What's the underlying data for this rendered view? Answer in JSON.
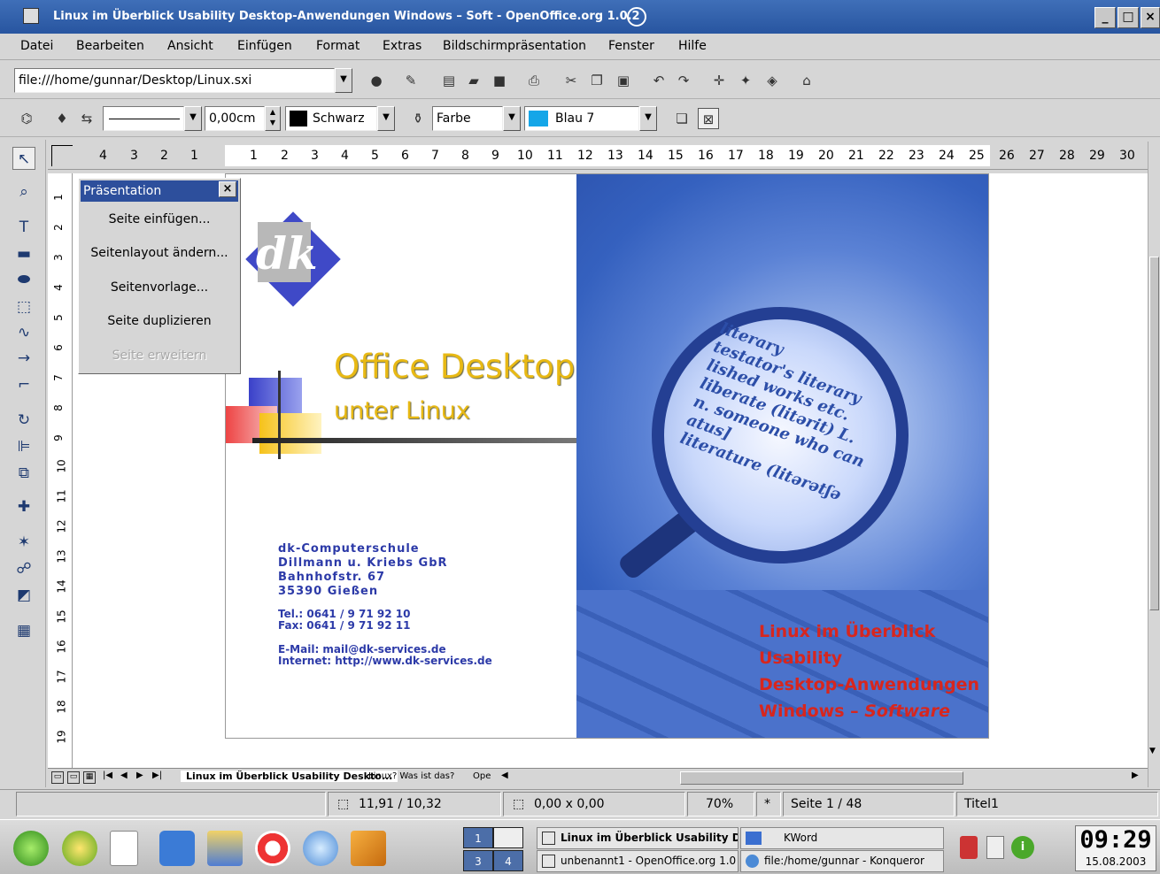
{
  "window": {
    "title": "Linux im Überblick Usability Desktop-Anwendungen Windows – Soft - OpenOffice.org 1.0.2"
  },
  "menu": [
    "Datei",
    "Bearbeiten",
    "Ansicht",
    "Einfügen",
    "Format",
    "Extras",
    "Bildschirmpräsentation",
    "Fenster",
    "Hilfe"
  ],
  "toolbar": {
    "url": "file:///home/gunnar/Desktop/Linux.sxi"
  },
  "objectbar": {
    "line_width": "0,00cm",
    "line_color": "Schwarz",
    "fill_type": "Farbe",
    "fill_color": "Blau 7"
  },
  "ruler": {
    "h_left": [
      "4",
      "3",
      "2",
      "1"
    ],
    "h_right": [
      "1",
      "2",
      "3",
      "4",
      "5",
      "6",
      "7",
      "8",
      "9",
      "10",
      "11",
      "12",
      "13",
      "14",
      "15",
      "16",
      "17",
      "18",
      "19",
      "20",
      "21",
      "22",
      "23",
      "24",
      "25",
      "26",
      "27",
      "28",
      "29",
      "30"
    ],
    "v": [
      "1",
      "2",
      "3",
      "4",
      "5",
      "6",
      "7",
      "8",
      "9",
      "10",
      "11",
      "12",
      "13",
      "14",
      "15",
      "16",
      "17",
      "18",
      "19"
    ]
  },
  "panel": {
    "title": "Präsentation",
    "items": [
      "Seite einfügen...",
      "Seitenlayout ändern...",
      "Seitenvorlage...",
      "Seite duplizieren",
      "Seite erweitern"
    ]
  },
  "slide": {
    "logo": "dk",
    "title": "Office Desktop",
    "subtitle": "unter Linux",
    "address": [
      "dk-Computerschule",
      "Dillmann u. Kriebs GbR",
      "Bahnhofstr. 67",
      "35390 Gießen"
    ],
    "phone": [
      "Tel.: 0641 / 9 71 92 10",
      "Fax: 0641 / 9 71 92 11"
    ],
    "web": [
      "E-Mail: mail@dk-services.de",
      "Internet: http://www.dk-services.de"
    ],
    "topics": [
      "Linux im Überblick",
      "Usability",
      "Desktop-Anwendungen",
      "Windows – "
    ],
    "topics_italic": "Software",
    "lens_text": [
      "literary",
      "testator's literary",
      "lished works etc.",
      "liberate (litərit) L.",
      "n. someone who can",
      "atus]",
      "literature (litərətʃə"
    ]
  },
  "tabs": [
    "Linux im Überblick Usability Deskto...",
    "Linux? Was ist das?",
    "Ope"
  ],
  "status": {
    "position": "11,91 / 10,32",
    "size": "0,00 x 0,00",
    "zoom": "70%",
    "modified": "*",
    "page": "Seite 1 / 48",
    "layout": "Titel1"
  },
  "taskbar": {
    "pager": [
      "1",
      "3",
      "4"
    ],
    "tasks": [
      "Linux im Überblick Usability De",
      "KWord",
      "unbenannt1 - OpenOffice.org 1.0",
      "file:/home/gunnar - Konqueror"
    ],
    "clock": "09:29",
    "date": "15.08.2003"
  }
}
